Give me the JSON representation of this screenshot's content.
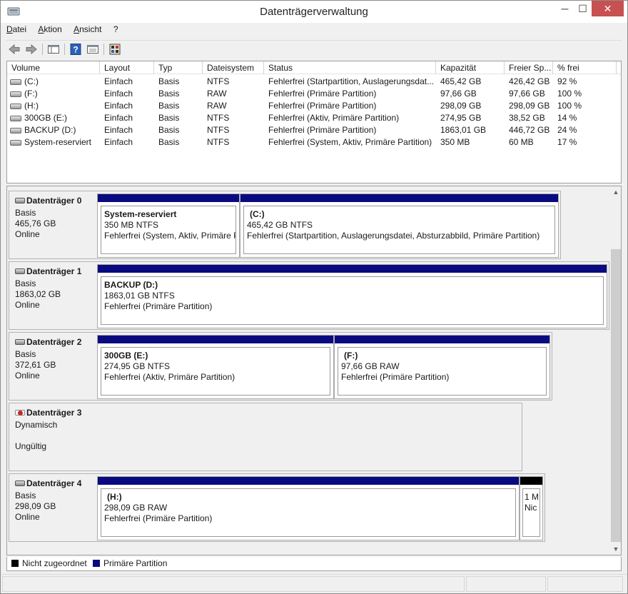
{
  "window": {
    "title": "Datenträgerverwaltung",
    "min_glyph": "─",
    "max_glyph": "☐",
    "close_glyph": "✕"
  },
  "menu": [
    "Datei",
    "Aktion",
    "Ansicht",
    "?"
  ],
  "toolbar_icons": [
    "back-arrow-icon",
    "forward-arrow-icon",
    "show-hide-console-tree-icon",
    "help-icon",
    "properties-icon",
    "disk-settings-icon"
  ],
  "volume_list": {
    "headers": [
      "Volume",
      "Layout",
      "Typ",
      "Dateisystem",
      "Status",
      "Kapazität",
      "Freier Sp...",
      "% frei"
    ],
    "rows": [
      [
        "(C:)",
        "Einfach",
        "Basis",
        "NTFS",
        "Fehlerfrei (Startpartition, Auslagerungsdat...",
        "465,42 GB",
        "426,42 GB",
        "92 %"
      ],
      [
        "(F:)",
        "Einfach",
        "Basis",
        "RAW",
        "Fehlerfrei (Primäre Partition)",
        "97,66 GB",
        "97,66 GB",
        "100 %"
      ],
      [
        "(H:)",
        "Einfach",
        "Basis",
        "RAW",
        "Fehlerfrei (Primäre Partition)",
        "298,09 GB",
        "298,09 GB",
        "100 %"
      ],
      [
        "300GB (E:)",
        "Einfach",
        "Basis",
        "NTFS",
        "Fehlerfrei (Aktiv, Primäre Partition)",
        "274,95 GB",
        "38,52 GB",
        "14 %"
      ],
      [
        "BACKUP (D:)",
        "Einfach",
        "Basis",
        "NTFS",
        "Fehlerfrei (Primäre Partition)",
        "1863,01 GB",
        "446,72 GB",
        "24 %"
      ],
      [
        "System-reserviert",
        "Einfach",
        "Basis",
        "NTFS",
        "Fehlerfrei (System, Aktiv, Primäre Partition)",
        "350 MB",
        "60 MB",
        "17 %"
      ]
    ]
  },
  "disks": [
    {
      "name": "Datenträger 0",
      "type": "Basis",
      "size": "465,76 GB",
      "state": "Online",
      "partitions": [
        {
          "name": "System-reserviert",
          "size": "350 MB NTFS",
          "status": "Fehlerfrei (System, Aktiv, Primäre Partition)"
        },
        {
          "name": "(C:)",
          "size": "465,42 GB NTFS",
          "status": "Fehlerfrei (Startpartition, Auslagerungsdatei, Absturzabbild, Primäre Partition)"
        }
      ]
    },
    {
      "name": "Datenträger 1",
      "type": "Basis",
      "size": "1863,02 GB",
      "state": "Online",
      "partitions": [
        {
          "name": "BACKUP  (D:)",
          "size": "1863,01 GB NTFS",
          "status": "Fehlerfrei (Primäre Partition)"
        }
      ]
    },
    {
      "name": "Datenträger 2",
      "type": "Basis",
      "size": "372,61 GB",
      "state": "Online",
      "partitions": [
        {
          "name": "300GB  (E:)",
          "size": "274,95 GB NTFS",
          "status": "Fehlerfrei (Aktiv, Primäre Partition)"
        },
        {
          "name": "(F:)",
          "size": "97,66 GB RAW",
          "status": "Fehlerfrei (Primäre Partition)"
        }
      ]
    },
    {
      "name": "Datenträger 3",
      "type": "Dynamisch",
      "size": "",
      "state": "Ungültig",
      "partitions": []
    },
    {
      "name": "Datenträger 4",
      "type": "Basis",
      "size": "298,09 GB",
      "state": "Online",
      "partitions": [
        {
          "name": "(H:)",
          "size": "298,09 GB RAW",
          "status": "Fehlerfrei (Primäre Partition)"
        },
        {
          "name": "",
          "size": "1 M",
          "status": "Nic"
        }
      ]
    }
  ],
  "legend": [
    {
      "label": "Nicht zugeordnet",
      "color": "#000000"
    },
    {
      "label": "Primäre Partition",
      "color": "#0a0a80"
    }
  ]
}
